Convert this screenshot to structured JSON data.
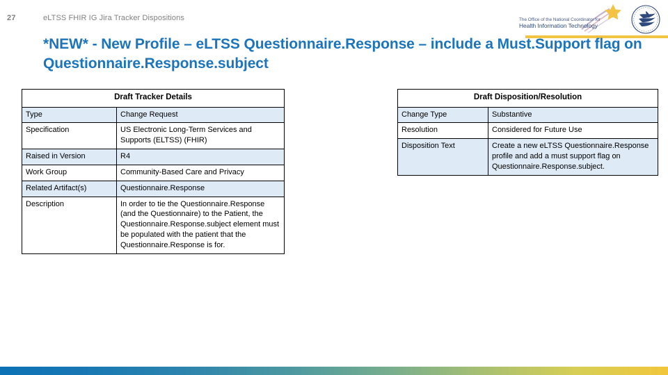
{
  "header": {
    "page_number": "27",
    "label": "eLTSS FHIR IG Jira Tracker Dispositions"
  },
  "logos": {
    "onc_line1": "The Office of the National Coordinator for",
    "onc_line2": "Health Information Technology",
    "onc_name": "onc-logo",
    "hhs_name": "hhs-seal-logo"
  },
  "title": "*NEW* - New Profile – eLTSS Questionnaire.Response – include a Must.Support flag on Questionnaire.Response.subject",
  "theme": {
    "title_color": "#1C75BC",
    "row_shade_color": "#DEEAF6",
    "gold_rule_color": "#F2C443",
    "bar_start_color": "#0C72B5",
    "bar_end_color": "#F2C63C"
  },
  "tracker_table": {
    "caption": "Draft Tracker Details",
    "rows": [
      {
        "label": "Type",
        "value": "Change Request"
      },
      {
        "label": "Specification",
        "value": "US Electronic Long-Term Services and Supports (ELTSS) (FHIR)"
      },
      {
        "label": "Raised in Version",
        "value": "R4"
      },
      {
        "label": "Work Group",
        "value": "Community-Based Care and Privacy"
      },
      {
        "label": "Related Artifact(s)",
        "value": "Questionnaire.Response"
      },
      {
        "label": "Description",
        "value": "In order to tie the Questionnaire.Response (and the Questionnaire) to the Patient, the Questionnaire.Response.subject element must be populated with the patient that the Questionnaire.Response is for."
      }
    ]
  },
  "disposition_table": {
    "caption": "Draft Disposition/Resolution",
    "rows": [
      {
        "label": "Change Type",
        "value": "Substantive"
      },
      {
        "label": "Resolution",
        "value": "Considered for Future Use"
      },
      {
        "label": "Disposition Text",
        "value": "Create a new eLTSS Questionnaire.Response profile and add a must support flag on Questionnaire.Response.subject."
      }
    ]
  }
}
